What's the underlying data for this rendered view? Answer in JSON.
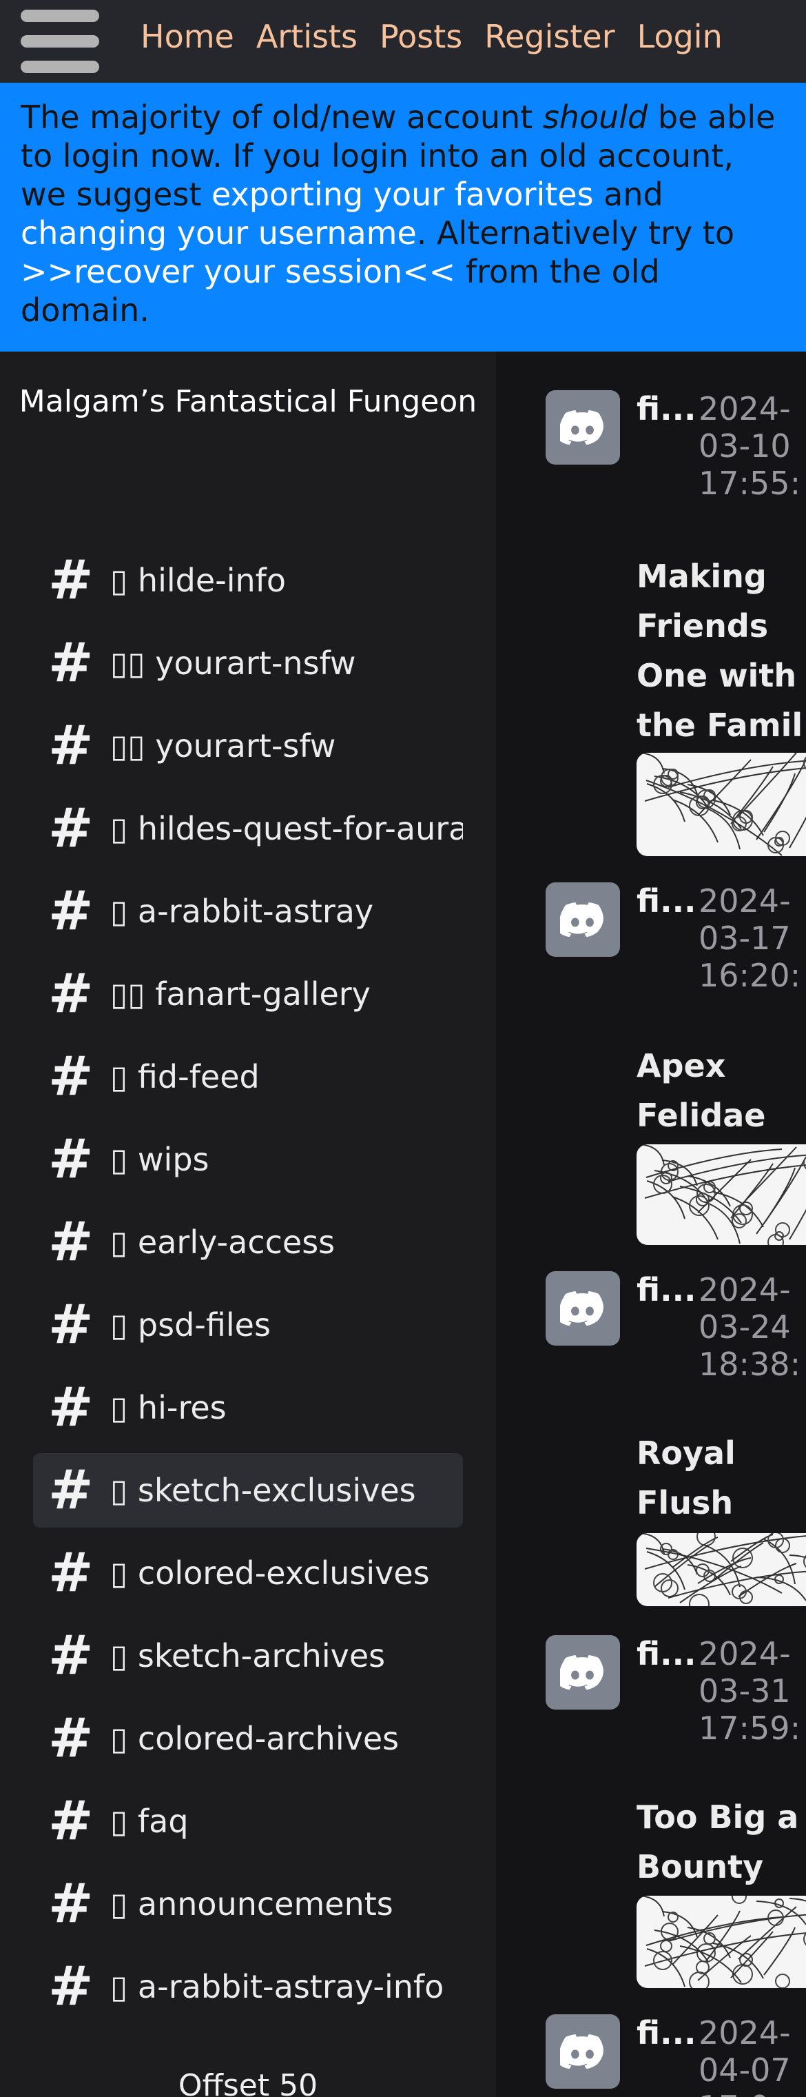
{
  "nav": {
    "menu_icon": "hamburger-menu-icon",
    "links": [
      "Home",
      "Artists",
      "Posts",
      "Register",
      "Login"
    ]
  },
  "notice": {
    "part1": "The majority of old/new account ",
    "part_em": "should",
    "part2": " be able to login now. If you login into an old account, we suggest ",
    "link_export": "exporting your favorites",
    "part3": " and ",
    "link_username": "changing your username",
    "part4": ". Alternatively try to ",
    "link_recover": ">>recover your session<<",
    "part5": " from the old domain."
  },
  "sidebar": {
    "server_name": "Malgam’s Fantastical Fungeon",
    "channel_icon": "hash-icon",
    "channels": [
      "▯ hilde-info",
      "▯▯ yourart-nsfw",
      "▯▯ yourart-sfw",
      "▯ hildes-quest-for-aura",
      "▯ a-rabbit-astray",
      "▯▯ fanart-gallery",
      "▯ fid-feed",
      "▯ wips",
      "▯ early-access",
      "▯ psd-files",
      "▯ hi-res",
      "▯ sketch-exclusives",
      "▯ colored-exclusives",
      "▯ sketch-archives",
      "▯ colored-archives",
      "▯ faq",
      "▯ announcements",
      "▯ a-rabbit-astray-info"
    ],
    "active_channel": "sketch-exclusives",
    "offset_label": "Offset 50"
  },
  "feed": {
    "avatar_icon": "discord-icon",
    "posts": [
      {
        "author": "fi...",
        "date": "2024-\n03-10\n17:55:",
        "title": "Making\nFriends\nOne with\nthe Famil"
      },
      {
        "author": "fi...",
        "date": "2024-\n03-17\n16:20:",
        "title": "Apex\nFelidae"
      },
      {
        "author": "fi...",
        "date": "2024-\n03-24\n18:38:",
        "title": "Royal\nFlush"
      },
      {
        "author": "fi...",
        "date": "2024-\n03-31\n17:59:",
        "title": "Too Big a\nBounty"
      },
      {
        "author": "fi...",
        "date": "2024-\n04-07\n17:0",
        "title": ""
      }
    ]
  }
}
